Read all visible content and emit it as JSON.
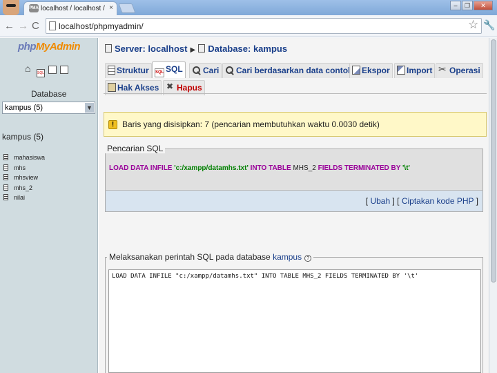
{
  "browser": {
    "tab_title": "localhost / localhost / kampus",
    "tab_close": "×",
    "favicon_text": "PMA",
    "url": "localhost/phpmyadmin/",
    "win_min": "–",
    "win_max": "❐",
    "win_close": "✕",
    "back": "←",
    "forward": "→",
    "reload": "C",
    "star": "☆",
    "wrench": "🔧"
  },
  "sidebar": {
    "logo_php": "php",
    "logo_myadmin": "MyAdmin",
    "database_label": "Database",
    "selected_db": "kampus (5)",
    "db_heading": "kampus (5)",
    "tables": [
      "mahasiswa",
      "mhs",
      "mhsview",
      "mhs_2",
      "nilai"
    ],
    "sql_icon_text": "SQL"
  },
  "breadcrumb": {
    "server": "Server: localhost",
    "database": "Database: kampus"
  },
  "tabs": [
    {
      "label": "Struktur"
    },
    {
      "label": "SQL"
    },
    {
      "label": "Cari"
    },
    {
      "label": "Cari berdasarkan data contoh"
    },
    {
      "label": "Ekspor"
    },
    {
      "label": "Import"
    },
    {
      "label": "Operasi"
    },
    {
      "label": "Hak Akses"
    },
    {
      "label": "Hapus"
    }
  ],
  "notice": {
    "icon": "!",
    "text": "Baris yang disisipkan: 7 (pencarian membutuhkan waktu 0.0030 detik)"
  },
  "sql_query": {
    "legend": "Pencarian SQL",
    "kw1": "LOAD DATA INFILE",
    "str1": "'c:/xampp/datamhs.txt'",
    "kw2": "INTO TABLE",
    "table": "MHS_2",
    "kw3": "FIELDS TERMINATED BY",
    "str2": "'\\t'",
    "link_edit": "Ubah",
    "link_php": "Ciptakan kode PHP"
  },
  "run_sql": {
    "legend_prefix": "Melaksanakan perintah SQL pada database",
    "db_link": "kampus",
    "help_icon": "?",
    "textarea_value": "LOAD DATA INFILE \"c:/xampp/datamhs.txt\" INTO TABLE MHS_2 FIELDS TERMINATED BY '\\t'"
  }
}
